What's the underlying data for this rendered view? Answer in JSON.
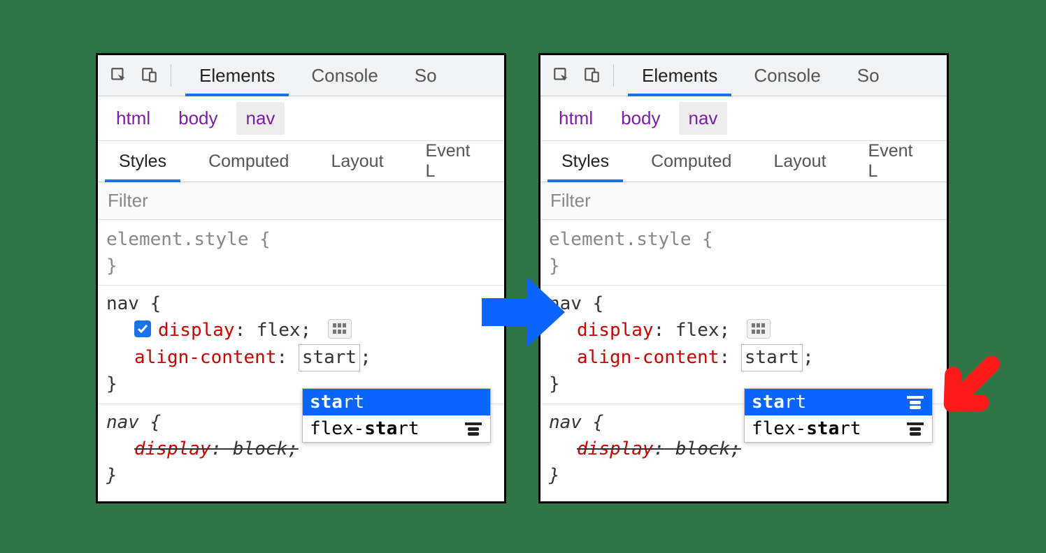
{
  "mainTabs": {
    "t0": "Elements",
    "t1": "Console",
    "t2": "So"
  },
  "breadcrumb": {
    "b0": "html",
    "b1": "body",
    "b2": "nav"
  },
  "subTabs": {
    "s0": "Styles",
    "s1": "Computed",
    "s2": "Layout",
    "s3": "Event L"
  },
  "filter": {
    "placeholder": "Filter"
  },
  "styles": {
    "elementStyle": "element.style {",
    "closeBrace": "}",
    "navOpen": "nav {",
    "displayProp": "display",
    "displayVal": "flex",
    "alignProp": "align-content",
    "alignValTyped": "start",
    "semicolon": ";",
    "colon": ":",
    "userAgentNavOpen": "nav {",
    "uaDisplayProp": "display",
    "uaDisplayVal": "block"
  },
  "autocomplete": {
    "o0_pre": "sta",
    "o0_suf": "rt",
    "o1_pre": "flex-",
    "o1_mid": "sta",
    "o1_suf": "rt"
  },
  "colors": {
    "accent": "#1a73e8",
    "prop": "#c80000",
    "background": "#2f7545"
  }
}
